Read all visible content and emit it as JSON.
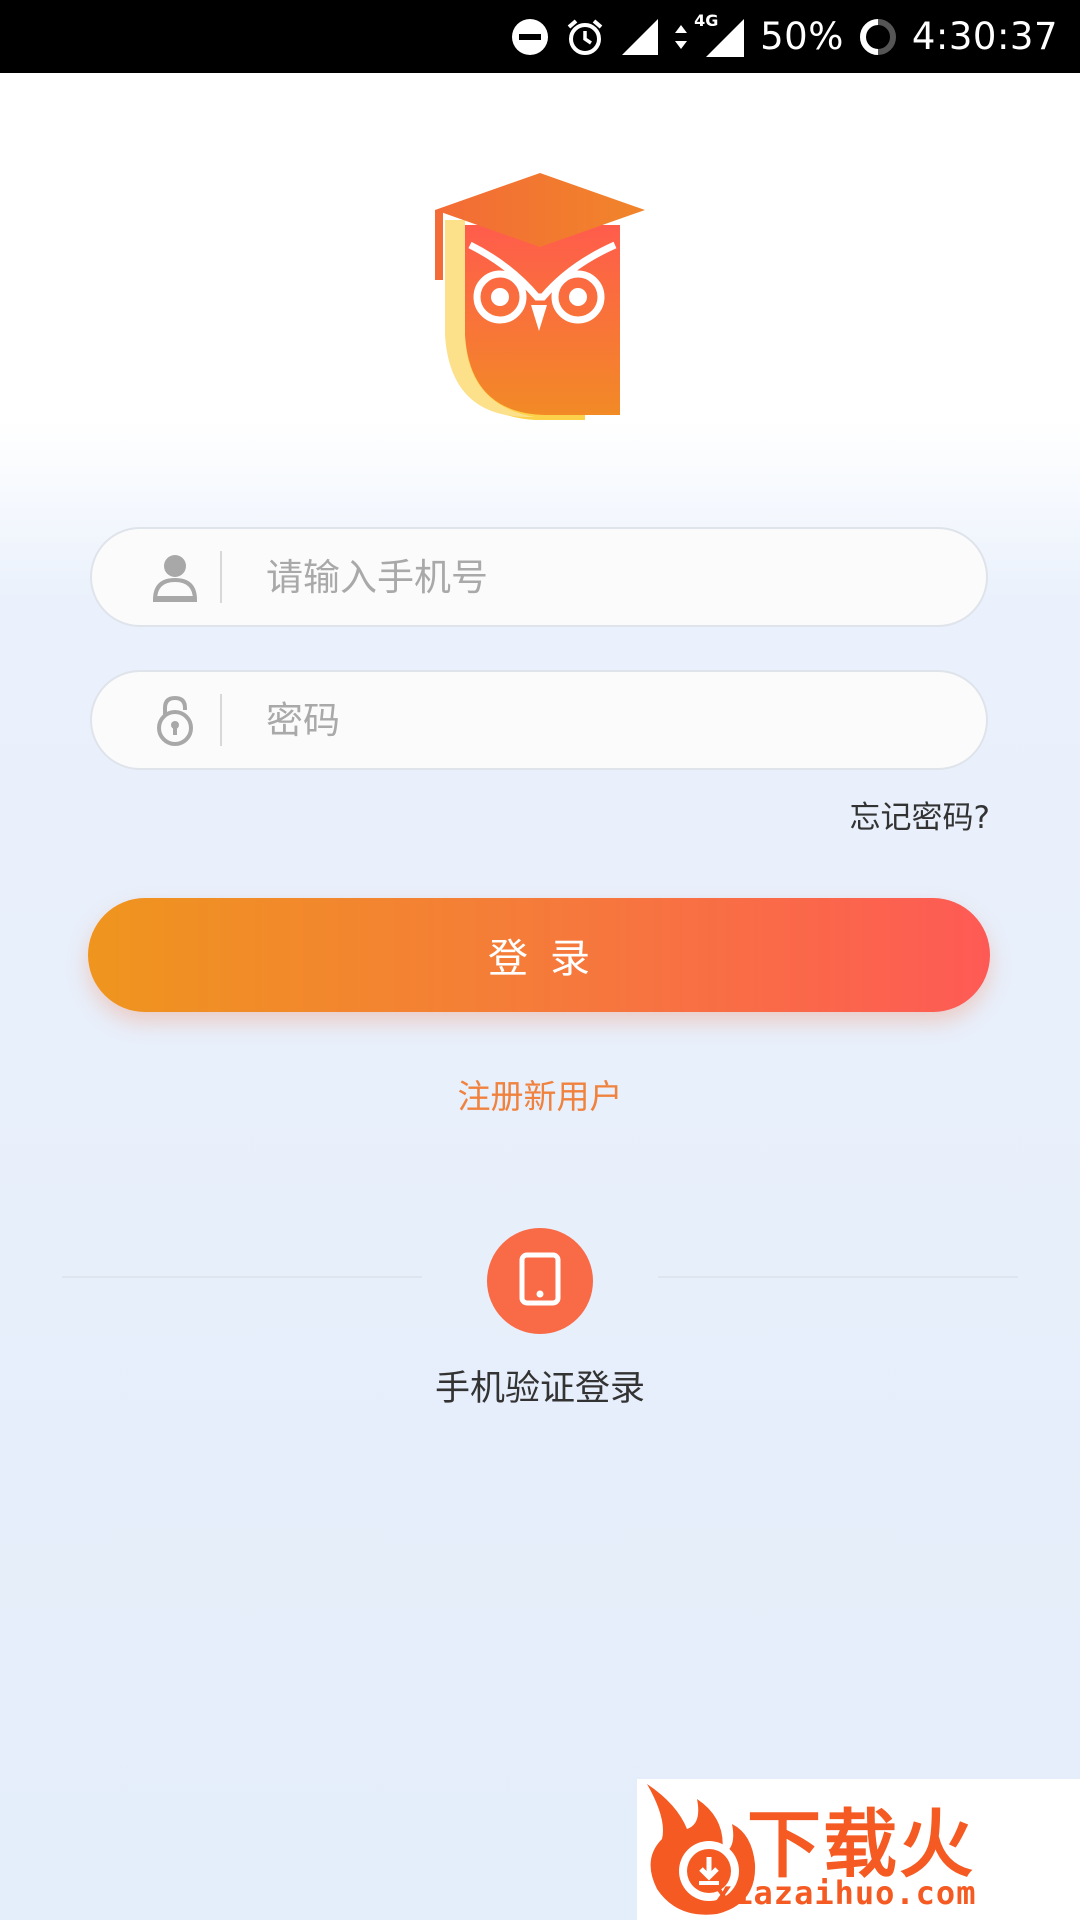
{
  "status_bar": {
    "battery": "50%",
    "time": "4:30:37",
    "network": "4G",
    "icons": [
      "do-not-disturb-icon",
      "alarm-icon",
      "signal-icon",
      "data-arrows-icon",
      "signal-4g-icon",
      "battery-ring-icon"
    ]
  },
  "login_form": {
    "phone_placeholder": "请输入手机号",
    "phone_value": "",
    "password_placeholder": "密码",
    "password_value": "",
    "phone_icon": "user-icon",
    "password_icon": "lock-icon",
    "forgot_label": "忘记密码?",
    "login_label": "登录",
    "register_label": "注册新用户"
  },
  "alt_login": {
    "icon": "phone-icon",
    "label": "手机验证登录"
  },
  "watermark": {
    "brand": "下载火",
    "url": "xiazaihuo.com"
  },
  "colors": {
    "accent_orange": "#f57b3a",
    "gradient_start": "#ef951e",
    "gradient_end": "#fe5a55",
    "link_orange": "#f0823e",
    "phone_circle": "#f96a47"
  }
}
